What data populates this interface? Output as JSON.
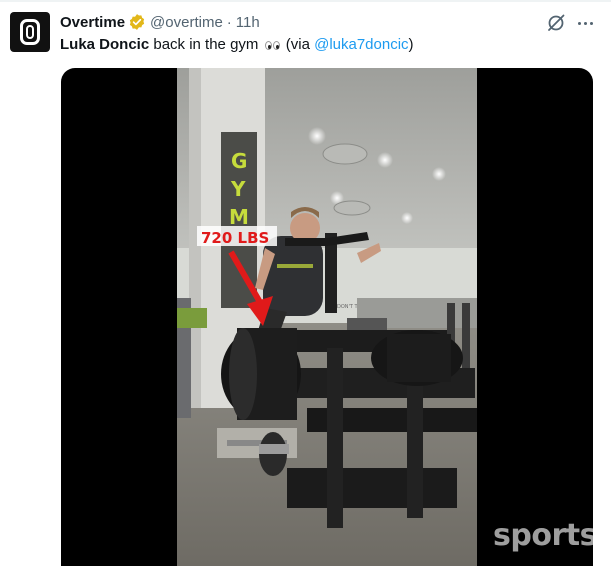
{
  "tweet": {
    "display_name": "Overtime",
    "handle": "@overtime",
    "separator": "·",
    "time": "11h",
    "text_bold": "Luka Doncic",
    "text_main": " back in the gym",
    "text_via_open": " (via ",
    "mention": "@luka7doncic",
    "text_via_close": ")"
  },
  "video": {
    "overlay_label": "720 LBS",
    "sign_text": "DON'T THROW WEIGHTS",
    "wall_letters": "GYM"
  },
  "watermark": "sports",
  "colors": {
    "link": "#1d9bf0",
    "verified_badge": "#e2b719",
    "overlay_red": "#e01a1a",
    "wall_letters": "#c6dc3c"
  },
  "icons": [
    "verified-badge-icon",
    "grok-icon",
    "more-icon"
  ]
}
